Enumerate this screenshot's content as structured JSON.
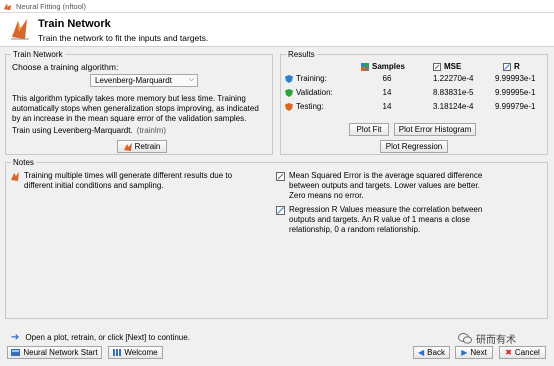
{
  "window": {
    "title": "Neural Fitting (nftool)"
  },
  "header": {
    "title": "Train Network",
    "subtitle": "Train the network to fit the inputs and targets."
  },
  "train_network": {
    "panel_title": "Train Network",
    "choose_label": "Choose a training algorithm:",
    "algorithm_selected": "Levenberg-Marquardt",
    "description": "This algorithm typically takes more memory but less time. Training automatically stops when generalization stops improving, as indicated by an increase in the mean square error of the validation samples.",
    "train_using_label": "Train using Levenberg-Marquardt.",
    "train_fn": "(trainlm)",
    "retrain_label": "Retrain"
  },
  "results": {
    "panel_title": "Results",
    "col_samples": "Samples",
    "col_mse": "MSE",
    "col_r": "R",
    "rows": [
      {
        "label": "Training:",
        "samples": "66",
        "mse": "1.22270e-4",
        "r": "9.99993e-1",
        "color": "#2f7fd3"
      },
      {
        "label": "Validation:",
        "samples": "14",
        "mse": "8.83831e-5",
        "r": "9.99995e-1",
        "color": "#2aa53c"
      },
      {
        "label": "Testing:",
        "samples": "14",
        "mse": "3.18124e-4",
        "r": "9.99979e-1",
        "color": "#d96a1c"
      }
    ],
    "plot_fit_label": "Plot Fit",
    "plot_error_hist_label": "Plot Error Histogram",
    "plot_regression_label": "Plot Regression"
  },
  "notes": {
    "panel_title": "Notes",
    "note1": "Training multiple times will generate different results due to different initial conditions and sampling.",
    "note2": "Mean Squared Error is the average squared difference between outputs and targets. Lower values are better. Zero means no error.",
    "note3": "Regression R Values measure the correlation between outputs and targets. An R value of 1 means a close relationship, 0 a random relationship."
  },
  "footer": {
    "hint": "Open a plot, retrain, or click [Next] to continue.",
    "nn_start_label": "Neural Network Start",
    "welcome_label": "Welcome",
    "back_label": "Back",
    "next_label": "Next",
    "cancel_label": "Cancel",
    "watermark": "研而有术"
  }
}
